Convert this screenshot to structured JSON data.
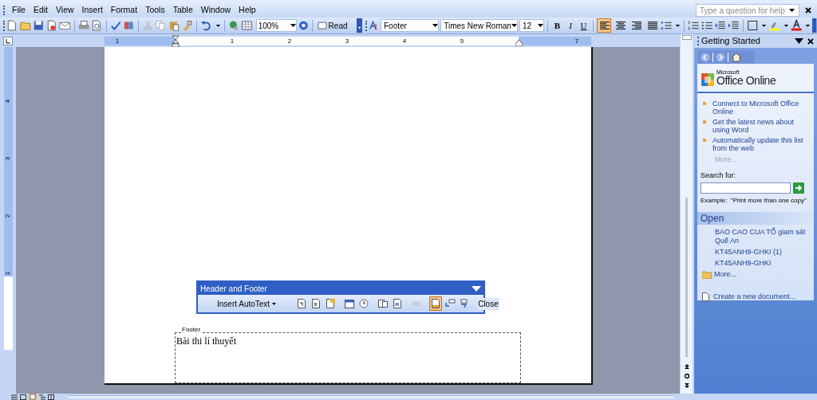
{
  "menu_bar": {
    "items": [
      "File",
      "Edit",
      "View",
      "Insert",
      "Format",
      "Tools",
      "Table",
      "Window",
      "Help"
    ]
  },
  "help_box": {
    "placeholder": "Type a question for help"
  },
  "standard_toolbar": {
    "zoom": "100%",
    "read_button": "Read"
  },
  "formatting_toolbar": {
    "style": "Footer",
    "font": "Times New Roman",
    "size": "12",
    "text_buttons": [
      "B",
      "I",
      "U"
    ],
    "alignment": [
      {
        "kind": "left",
        "selected": true
      },
      {
        "kind": "center",
        "selected": false
      },
      {
        "kind": "right",
        "selected": false
      },
      {
        "kind": "justify",
        "selected": false
      }
    ]
  },
  "horizontal_ruler": {
    "labels": [
      "1",
      "1",
      "2",
      "3",
      "4",
      "5",
      "7"
    ]
  },
  "vertical_ruler": {
    "labels": [
      "4",
      "3",
      "2",
      "1"
    ]
  },
  "header_footer_toolbar": {
    "title": "Header and Footer",
    "autotext_button": "Insert AutoText",
    "close_button": "Close",
    "tools": [
      {
        "kind": "page-number",
        "selected": false,
        "disabled": false
      },
      {
        "kind": "page-count",
        "selected": false,
        "disabled": false
      },
      {
        "kind": "format-number",
        "selected": false,
        "disabled": false
      },
      {
        "kind": "date",
        "selected": false,
        "disabled": false
      },
      {
        "kind": "time",
        "selected": false,
        "disabled": false
      },
      {
        "kind": "page-setup",
        "selected": false,
        "disabled": false
      },
      {
        "kind": "show-text",
        "selected": false,
        "disabled": false
      },
      {
        "kind": "link-previous",
        "selected": false,
        "disabled": true
      },
      {
        "kind": "switch",
        "selected": true,
        "disabled": false
      },
      {
        "kind": "previous",
        "selected": false,
        "disabled": false
      },
      {
        "kind": "next",
        "selected": false,
        "disabled": false
      }
    ]
  },
  "footer": {
    "tag": "Footer",
    "text": "Bài thi lí thuyết"
  },
  "task_pane": {
    "title": "Getting Started",
    "logo": {
      "brand": "Microsoft",
      "name": "Office Online"
    },
    "links": [
      "Connect to Microsoft Office Online",
      "Get the latest news about using Word",
      "Automatically update this list from the web"
    ],
    "more_link": "More...",
    "search_label": "Search for:",
    "example": "Example:  \"Print more than one copy\"",
    "open_section": {
      "title": "Open",
      "files": [
        "BAO CAO CUA TỔ giam sát Quế An",
        "KT45ANH9-GHKI (1)",
        "KT45ANH9-GHKI"
      ],
      "more": "More..."
    },
    "create_link": "Create a new document..."
  }
}
